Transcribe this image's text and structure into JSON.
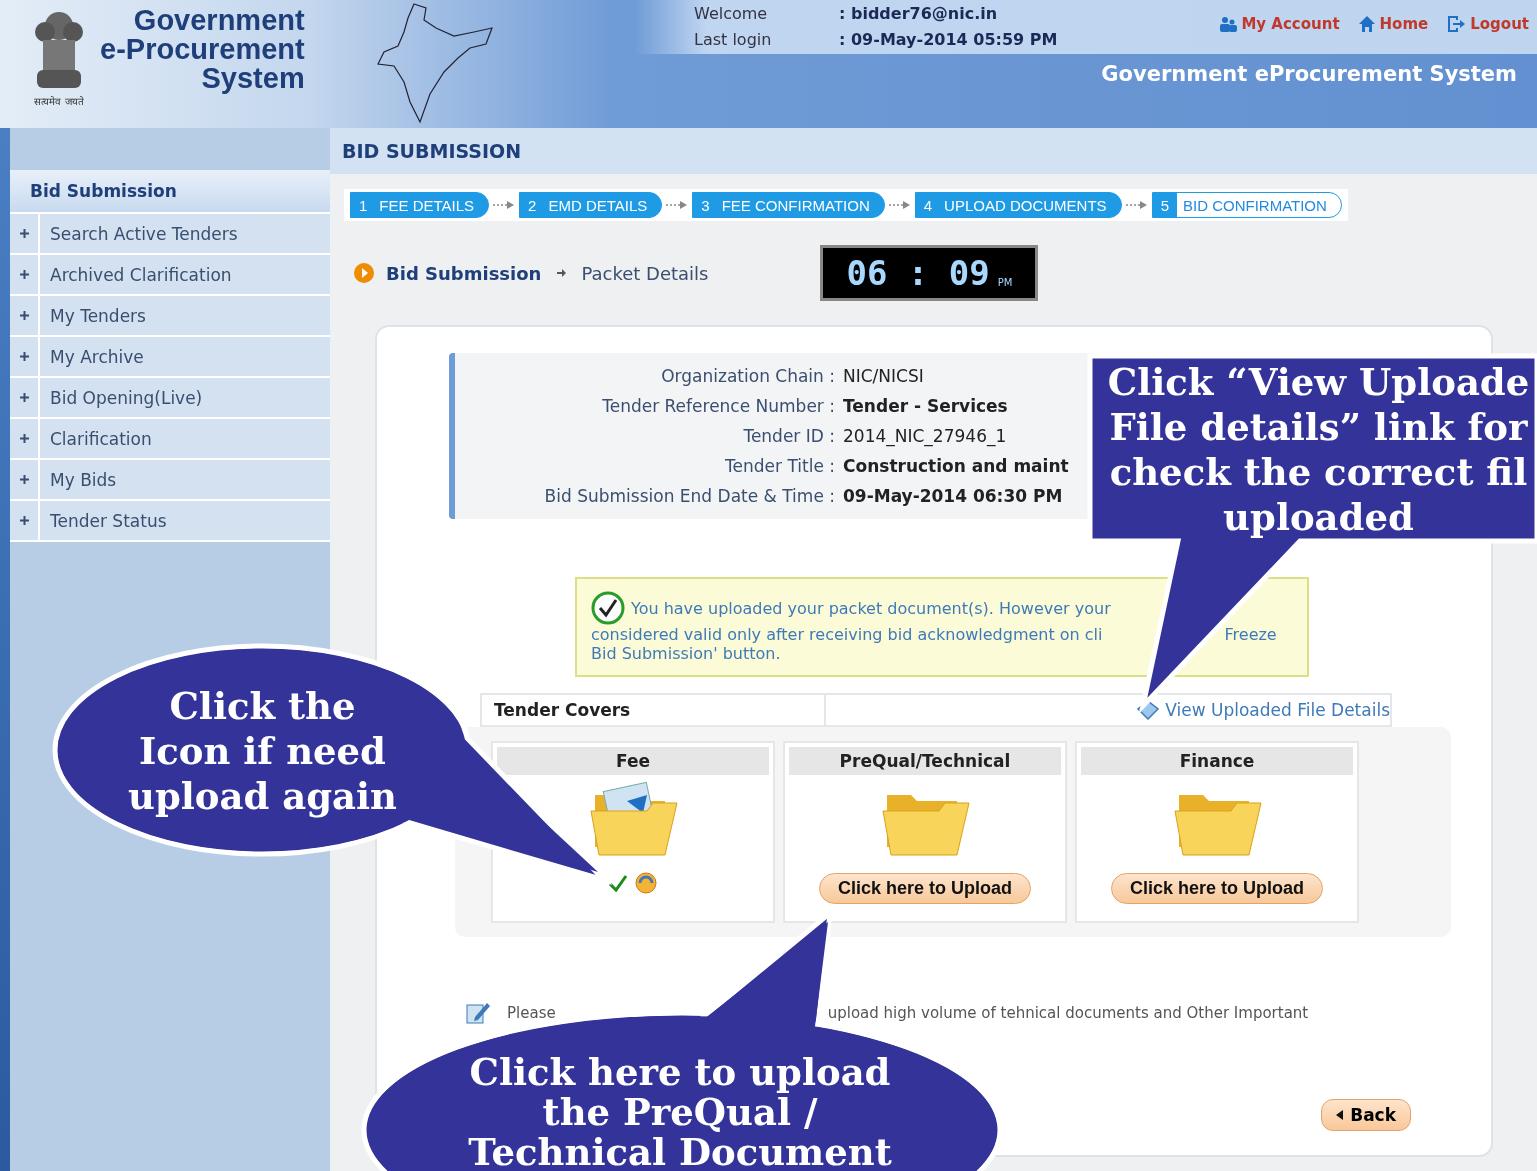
{
  "header": {
    "title_lines": [
      "Government",
      "e-Procurement",
      "System"
    ],
    "emblem_caption": "सत्यमेव जयते",
    "welcome_label": "Welcome",
    "welcome_value": ": bidder76@nic.in",
    "last_login_label": "Last login",
    "last_login_value": ": 09-May-2014 05:59 PM",
    "nav_links": [
      {
        "label": "My Account",
        "kind": "user"
      },
      {
        "label": "Home",
        "kind": "home"
      },
      {
        "label": "Logout",
        "kind": "logout"
      }
    ],
    "subtitle": "Government eProcurement System"
  },
  "sidebar": {
    "heading": "Bid Submission",
    "items": [
      "Search Active Tenders",
      "Archived Clarification",
      "My Tenders",
      "My Archive",
      "Bid Opening(Live)",
      "Clarification",
      "My Bids",
      "Tender Status"
    ]
  },
  "page_title": "BID SUBMISSION",
  "steps": [
    {
      "number": "1",
      "label": "FEE DETAILS",
      "selected": false
    },
    {
      "number": "2",
      "label": "EMD DETAILS",
      "selected": false
    },
    {
      "number": "3",
      "label": "FEE CONFIRMATION",
      "selected": false
    },
    {
      "number": "4",
      "label": "UPLOAD DOCUMENTS",
      "selected": false
    },
    {
      "number": "5",
      "label": "BID CONFIRMATION",
      "selected": true
    }
  ],
  "breadcrumb": [
    "Bid Submission",
    "Packet Details"
  ],
  "clock": {
    "time": "06 : 09",
    "period": "PM"
  },
  "tender_info": [
    {
      "label": "Organization Chain :",
      "value": "NIC/NICSI",
      "emphasis": false
    },
    {
      "label": "Tender Reference Number :",
      "value": "Tender - Services",
      "emphasis": true
    },
    {
      "label": "Tender ID :",
      "value": "2014_NIC_27946_1",
      "emphasis": false
    },
    {
      "label": "Tender Title :",
      "value": "Construction and maint",
      "emphasis": true
    },
    {
      "label": "Bid Submission End Date & Time :",
      "value": "09-May-2014 06:30 PM",
      "emphasis": true
    }
  ],
  "notice": {
    "line_1": "You have uploaded your packet document(s). However your",
    "line_2": "considered valid only after receiving bid acknowledgment on cli",
    "line_2_end": "Freeze",
    "line_3": "Bid Submission' button."
  },
  "covers": {
    "heading": "Tender Covers",
    "link": "View Uploaded File Details",
    "items": [
      {
        "title": "Fee",
        "uploaded": true
      },
      {
        "title": "PreQual/Technical",
        "uploaded": false,
        "button": "Click here to Upload"
      },
      {
        "title": "Finance",
        "uploaded": false,
        "button": "Click here to Upload"
      }
    ]
  },
  "note": {
    "start": "Please",
    "end": "upload high volume of tehnical documents and Other Important"
  },
  "back_button": "Back",
  "callouts": [
    {
      "kind": "box",
      "lines": [
        "Click “View Uploade",
        "File details” link for",
        "check the correct fil",
        "uploaded"
      ]
    },
    {
      "kind": "left",
      "lines": [
        "Click the",
        "Icon if need",
        "upload again"
      ]
    },
    {
      "kind": "bottom",
      "lines": [
        "Click here to upload",
        "the PreQual /",
        "Technical Document"
      ]
    }
  ]
}
